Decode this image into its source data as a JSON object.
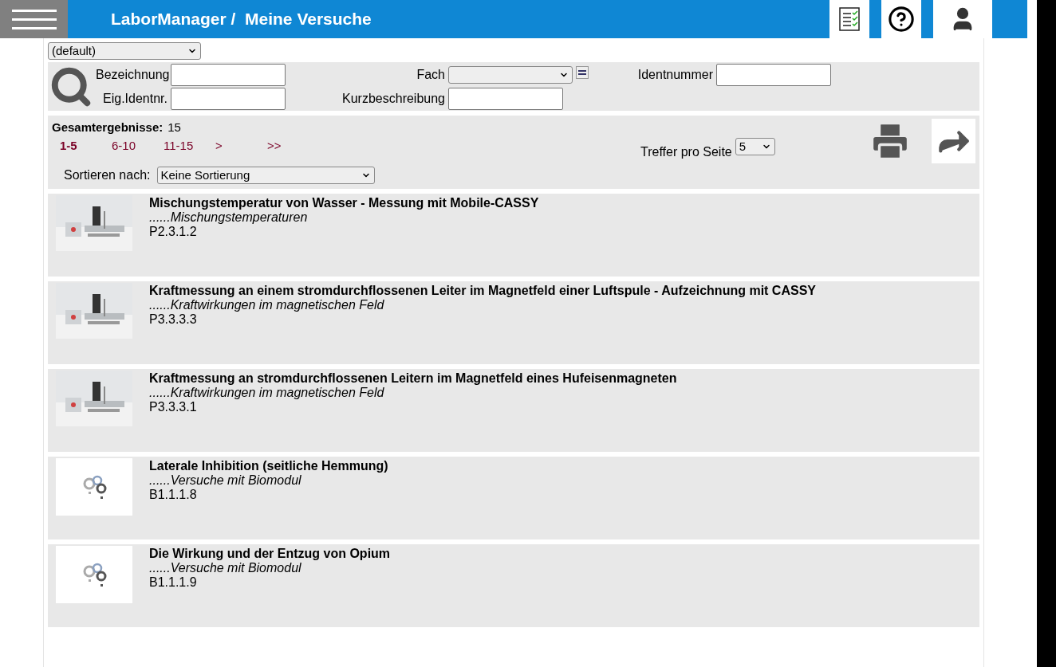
{
  "header": {
    "title": "LaborManager /  Meine Versuche"
  },
  "profile_select": {
    "value": "(default)"
  },
  "search": {
    "fields": [
      {
        "label": "Bezeichnung",
        "kind": "input"
      },
      {
        "label": "Fach",
        "kind": "select"
      },
      {
        "label": "Identnummer",
        "kind": "input"
      },
      {
        "label": "Eig.Identnr.",
        "kind": "input"
      },
      {
        "label": "Kurzbeschreibung",
        "kind": "input"
      }
    ]
  },
  "results": {
    "total_label": "Gesamtergebnisse:",
    "total": "15",
    "pages": [
      {
        "label": "1-5",
        "selected": true
      },
      {
        "label": "6-10",
        "selected": false
      },
      {
        "label": "11-15",
        "selected": false
      },
      {
        "label": ">",
        "selected": false
      },
      {
        "label": ">>",
        "selected": false
      }
    ],
    "per_page_label": "Treffer pro Seite",
    "per_page": "5",
    "sort_label": "Sortieren nach:",
    "sort": "Keine Sortierung"
  },
  "items": [
    {
      "title": "Mischungstemperatur von Wasser - Messung mit Mobile-CASSY",
      "topic": "......Mischungstemperaturen",
      "code": "P2.3.1.2"
    },
    {
      "title": "Kraftmessung an einem stromdurchflossenen Leiter im Magnetfeld einer Luftspule - Aufzeichnung mit CASSY",
      "topic": "......Kraftwirkungen im magnetischen Feld",
      "code": "P3.3.3.3"
    },
    {
      "title": "Kraftmessung an stromdurchflossenen Leitern im Magnetfeld eines Hufeisenmagneten",
      "topic": "......Kraftwirkungen im magnetischen Feld",
      "code": "P3.3.3.1"
    },
    {
      "title": "Laterale Inhibition (seitliche Hemmung)",
      "topic": "......Versuche mit Biomodul",
      "code": "B1.1.1.8",
      "kind": "placeholder"
    },
    {
      "title": "Die Wirkung und der Entzug von Opium",
      "topic": "......Versuche mit Biomodul",
      "code": "B1.1.1.9",
      "kind": "placeholder"
    }
  ]
}
